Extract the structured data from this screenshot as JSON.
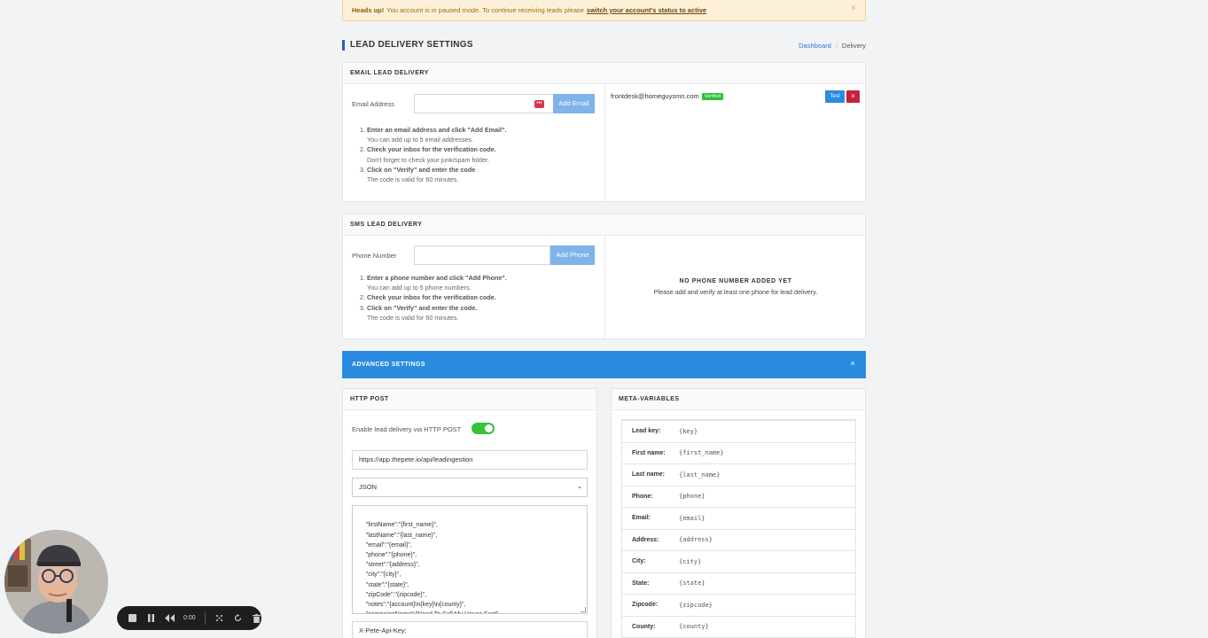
{
  "alert": {
    "strong": "Heads up!",
    "text": "You account is in paused mode. To continue receiving leads please",
    "link": "switch your account's status to active",
    "close": "×"
  },
  "page": {
    "title": "LEAD DELIVERY SETTINGS"
  },
  "breadcrumb": {
    "home": "Dashboard",
    "sep": "/",
    "current": "Delivery"
  },
  "email": {
    "title": "EMAIL LEAD DELIVERY",
    "label": "Email Address",
    "value": "",
    "button": "Add Email",
    "pwd_icon": "•••",
    "steps": [
      {
        "bold": "Enter an email address and click \"Add Email\".",
        "sub": "You can add up to 5 email addresses."
      },
      {
        "bold": "Check your inbox for the verification code.",
        "sub": "Don't forget to check your junk/spam folder."
      },
      {
        "bold": "Click on \"Verify\" and enter the code",
        "sub": "The code is valid for 60 minutes."
      }
    ],
    "entry": {
      "address": "frontdesk@homeguysmn.com",
      "status": "Verified",
      "test": "Test",
      "delete": "×"
    }
  },
  "sms": {
    "title": "SMS LEAD DELIVERY",
    "label": "Phone Number",
    "value": "",
    "button": "Add Phone",
    "steps": [
      {
        "bold": "Enter a phone number and click \"Add Phone\".",
        "sub": "You can add up to 5 phone numbers."
      },
      {
        "bold": "Check your inbox for the verification code.",
        "sub": ""
      },
      {
        "bold": "Click on \"Verify\" and enter the code.",
        "sub": "The code is valid for 60 minutes."
      }
    ],
    "empty_title": "NO PHONE NUMBER ADDED YET",
    "empty_sub": "Please add and verify at least one phone for lead delivery."
  },
  "advanced": {
    "title": "ADVANCED SETTINGS",
    "chevron": "^"
  },
  "http": {
    "title": "HTTP POST",
    "toggle_label": "Enable lead delivery via HTTP POST",
    "enabled": true,
    "url": "https://app.thepete.io/api/leadingestion",
    "format": "JSON",
    "format_arrow": "⌄",
    "body_lines": [
      "    \"firstName\":\"{first_name}\",",
      "    \"lastName\":\"{last_name}\",",
      "    \"email\":\"{email}\",",
      "    \"phone\":\"{phone}\",",
      "    \"street\":\"{address}\",",
      "    \"city\":\"{city}\",",
      "    \"state\":\"{state}\",",
      "    \"zipCode\":\"{zipcode}\",",
      "    \"notes\":\"{account}\\n{key}\\n{county}\",",
      "    \"campaignName\":\"Need To Sell My House Fast\"",
      "}"
    ],
    "header_field": "X-Pete-Api-Key:"
  },
  "meta": {
    "title": "META-VARIABLES",
    "rows": [
      {
        "key": "Lead key:",
        "var": "{key}"
      },
      {
        "key": "First name:",
        "var": "{first_name}"
      },
      {
        "key": "Last name:",
        "var": "{last_name}"
      },
      {
        "key": "Phone:",
        "var": "{phone}"
      },
      {
        "key": "Email:",
        "var": "{email}"
      },
      {
        "key": "Address:",
        "var": "{address}"
      },
      {
        "key": "City:",
        "var": "{city}"
      },
      {
        "key": "State:",
        "var": "{state}"
      },
      {
        "key": "Zipcode:",
        "var": "{zipcode}"
      },
      {
        "key": "County:",
        "var": "{county}"
      }
    ]
  },
  "player": {
    "time": "0:00"
  }
}
